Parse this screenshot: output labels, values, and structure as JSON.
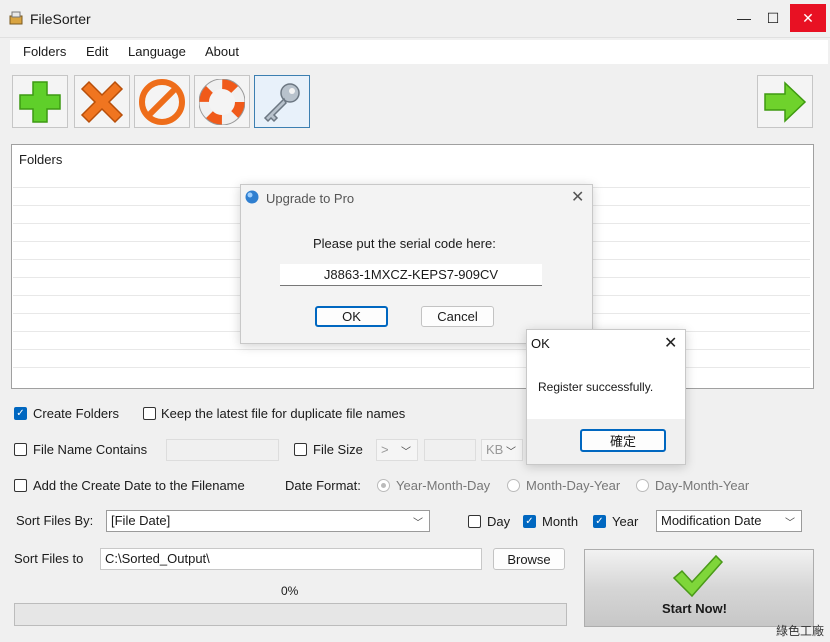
{
  "window": {
    "title": "FileSorter",
    "minimize": "—",
    "maximize": "☐",
    "close": "✕"
  },
  "menu": [
    "Folders",
    "Edit",
    "Language",
    "About"
  ],
  "toolbar": {
    "buttons": [
      {
        "name": "add-folder-button",
        "icon": "plus-icon"
      },
      {
        "name": "remove-folder-button",
        "icon": "x-icon"
      },
      {
        "name": "clear-button",
        "icon": "no-entry-icon"
      },
      {
        "name": "help-button",
        "icon": "lifebuoy-icon"
      },
      {
        "name": "register-button",
        "icon": "key-icon"
      }
    ],
    "next_icon": "arrow-right-icon"
  },
  "folders": {
    "header": "Folders"
  },
  "options": {
    "create_folders": {
      "label": "Create Folders",
      "checked": true
    },
    "keep_latest": {
      "label": "Keep the latest file for duplicate file names",
      "checked": false
    },
    "file_name_contains": {
      "label": "File Name Contains",
      "checked": false,
      "value": ""
    },
    "file_size": {
      "label": "File Size",
      "checked": false,
      "operator": ">",
      "value": "",
      "unit": "KB"
    },
    "add_create_date": {
      "label": "Add the Create Date to the Filename",
      "checked": false
    },
    "date_format": {
      "label": "Date Format:",
      "options": [
        "Year-Month-Day",
        "Month-Day-Year",
        "Day-Month-Year"
      ],
      "selected": "Year-Month-Day"
    }
  },
  "sort": {
    "by_label": "Sort Files By:",
    "by_value": "[File Date]",
    "day": {
      "label": "Day",
      "checked": false
    },
    "month": {
      "label": "Month",
      "checked": true
    },
    "year": {
      "label": "Year",
      "checked": true
    },
    "date_type": "Modification Date",
    "to_label": "Sort Files to",
    "to_value": "C:\\Sorted_Output\\",
    "browse": "Browse"
  },
  "progress": {
    "text": "0%",
    "value": 0
  },
  "start": {
    "label": "Start Now!"
  },
  "upgrade_dialog": {
    "title": "Upgrade to Pro",
    "prompt": "Please put the serial code here:",
    "serial": "J8863-1MXCZ-KEPS7-909CV",
    "ok": "OK",
    "cancel": "Cancel"
  },
  "ok_dialog": {
    "title": "OK",
    "message": "Register successfully.",
    "confirm": "確定"
  },
  "watermark": "綠色工廠",
  "colors": {
    "accent": "#0067c0",
    "check_green": "#3fbf3f"
  }
}
